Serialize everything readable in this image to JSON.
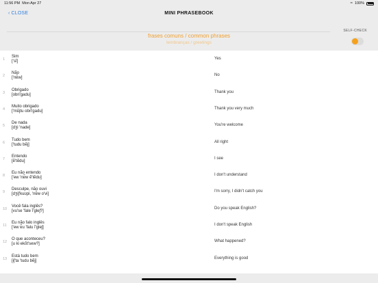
{
  "status": {
    "time": "11:56 PM",
    "date": "Mon Apr 27",
    "battery": "100%"
  },
  "nav": {
    "close_label": "CLOSE",
    "title": "MINI PHRASEBOOK"
  },
  "header": {
    "heading": "frases comuns / common phrases",
    "subheading": "lembranças / greetings",
    "selfcheck_label": "SELF-CHECK",
    "selfcheck_on": true,
    "accent": "#f5a11c"
  },
  "phrases": [
    {
      "n": "1",
      "pt": "Sim",
      "ipa": "['sĩ]",
      "en": "Yes"
    },
    {
      "n": "2",
      "pt": "Não",
      "ipa": "['nɐ̃w]",
      "en": "No"
    },
    {
      "n": "3",
      "pt": "Obrigado",
      "ipa": "[obri'gadu]",
      "en": "Thank you"
    },
    {
      "n": "4",
      "pt": "Muito obrigado",
      "ipa": "['mũjtu obri'gadu]",
      "en": "Thank you very much"
    },
    {
      "n": "5",
      "pt": "De nada",
      "ipa": "[dʒi 'nade]",
      "en": "You're welcome"
    },
    {
      "n": "6",
      "pt": "Tudo bem",
      "ipa": "['tudu bẽj]",
      "en": "All right"
    },
    {
      "n": "7",
      "pt": "Entendo",
      "ipa": "[ẽ'tẽdu]",
      "en": "I see"
    },
    {
      "n": "8",
      "pt": "Eu não entendo",
      "ipa": "['ew 'nɐ̃w ẽ'tẽdu]",
      "en": "I don't understand"
    },
    {
      "n": "9",
      "pt": "Desculpe, não ouvi",
      "ipa": "[dʒiʃ'kuʊpi, 'nɐ̃w o'vi]",
      "en": "I'm sorry, I didn't catch you"
    },
    {
      "n": "10",
      "pt": "Você fala inglês?",
      "ipa": "[vu'se 'fale ĩ'gleʃ?]",
      "en": "Do you speak English?"
    },
    {
      "n": "11",
      "pt": "Eu não falo inglês",
      "ipa": "['ew ɐ̃u 'falu ĩ'gleʃ]",
      "en": "I don't speak English"
    },
    {
      "n": "12",
      "pt": "O que aconteceu?",
      "ipa": "[u ki ekõt'sew?]",
      "en": "What happened?"
    },
    {
      "n": "13",
      "pt": "Está tudo bem",
      "ipa": "[iʃ'ta 'tudu bẽj]",
      "en": "Everything is good"
    }
  ]
}
